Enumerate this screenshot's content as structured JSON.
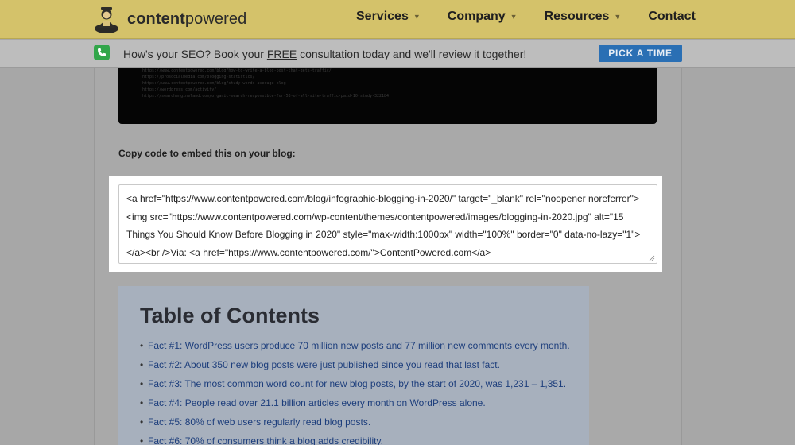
{
  "brand": {
    "name_bold": "content",
    "name_light": "powered"
  },
  "nav": {
    "items": [
      {
        "label": "Services",
        "has_caret": true
      },
      {
        "label": "Company",
        "has_caret": true
      },
      {
        "label": "Resources",
        "has_caret": true
      },
      {
        "label": "Contact",
        "has_caret": false
      }
    ]
  },
  "promo": {
    "text_before": "How's your SEO? Book your ",
    "text_free": "FREE",
    "text_after": " consultation today and we'll review it together!",
    "button_label": "PICK A TIME"
  },
  "code_preview": {
    "lines": [
      "https://www.contentpowered.com/blog/how-to-write-a-blog-post-that-gets-traffic/",
      "https://prosocialmedia.com/blogging-statistics/",
      "https://www.contentpowered.com/blog/study-words-average-blog",
      "https://wordpress.com/activity/",
      "https://searchengineland.com/organic-search-responsible-for-53-of-all-site-traffic-paid-10-study-322184"
    ]
  },
  "embed": {
    "label": "Copy code to embed this on your blog:",
    "code": "<a href=\"https://www.contentpowered.com/blog/infographic-blogging-in-2020/\" target=\"_blank\" rel=\"noopener noreferrer\"><img src=\"https://www.contentpowered.com/wp-content/themes/contentpowered/images/blogging-in-2020.jpg\" alt=\"15 Things You Should Know Before Blogging in 2020\" style=\"max-width:1000px\" width=\"100%\" border=\"0\" data-no-lazy=\"1\"></a><br />Via: <a href=\"https://www.contentpowered.com/\">ContentPowered.com</a>"
  },
  "toc": {
    "title": "Table of Contents",
    "items": [
      "Fact #1: WordPress users produce 70 million new posts and 77 million new comments every month.",
      "Fact #2: About 350 new blog posts were just published since you read that last fact.",
      "Fact #3: The most common word count for new blog posts, by the start of 2020, was 1,231 – 1,351.",
      "Fact #4: People read over 21.1 billion articles every month on WordPress alone.",
      "Fact #5: 80% of web users regularly read blog posts.",
      "Fact #6: 70% of consumers think a blog adds credibility."
    ]
  },
  "colors": {
    "header_bg": "#d4c26a",
    "button_bg": "#2a6fb4",
    "phone_green": "#32a64a",
    "link_blue": "#1d3e7c"
  },
  "icons": [
    "logo-mascot-icon",
    "caret-down-icon",
    "phone-icon",
    "resize-grip-icon"
  ]
}
